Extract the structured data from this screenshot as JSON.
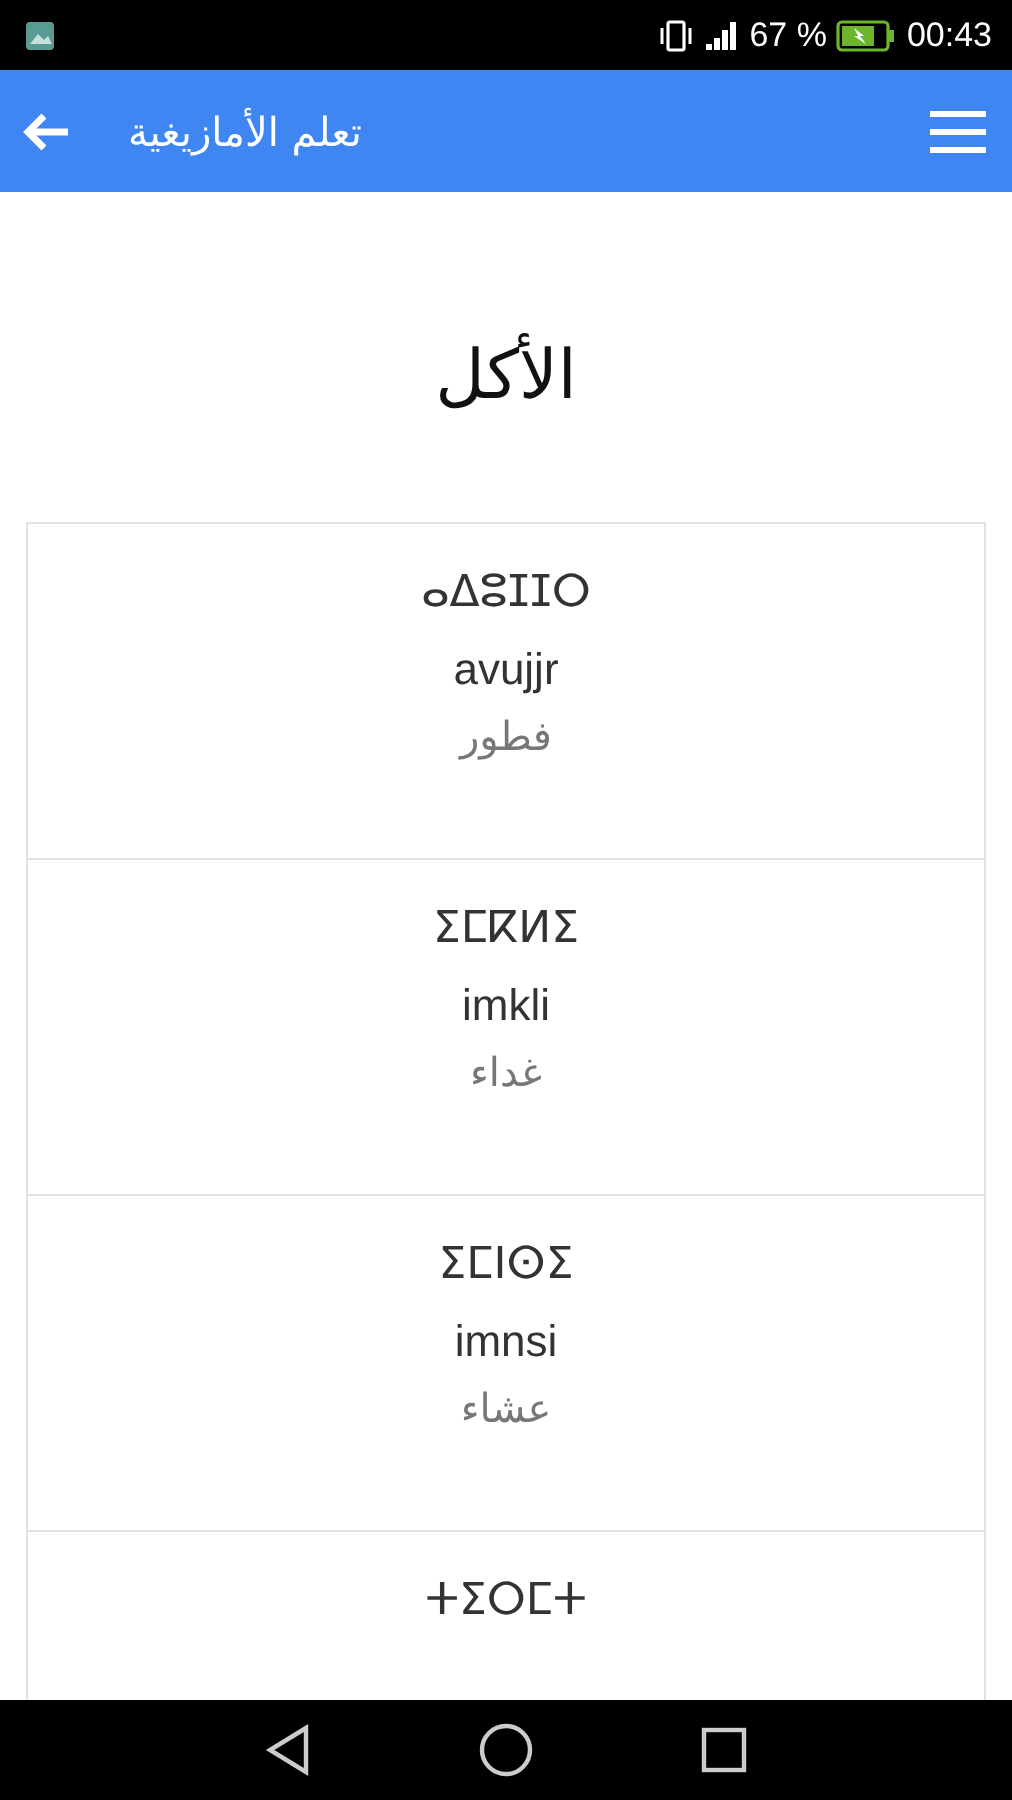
{
  "status_bar": {
    "battery": "67 %",
    "time": "00:43"
  },
  "app_bar": {
    "title": "تعلم الأمازيغية"
  },
  "heading": "الأكل",
  "words": [
    {
      "tifinagh": "ⴰⵠⵓⵊⵊⵔ",
      "latin": "avujjr",
      "arabic": "فطور"
    },
    {
      "tifinagh": "ⵉⵎⴽⵍⵉ",
      "latin": "imkli",
      "arabic": "غداء"
    },
    {
      "tifinagh": "ⵉⵎⵏⵙⵉ",
      "latin": "imnsi",
      "arabic": "عشاء"
    },
    {
      "tifinagh": "ⵜⵉⵔⵎⵜ"
    }
  ]
}
